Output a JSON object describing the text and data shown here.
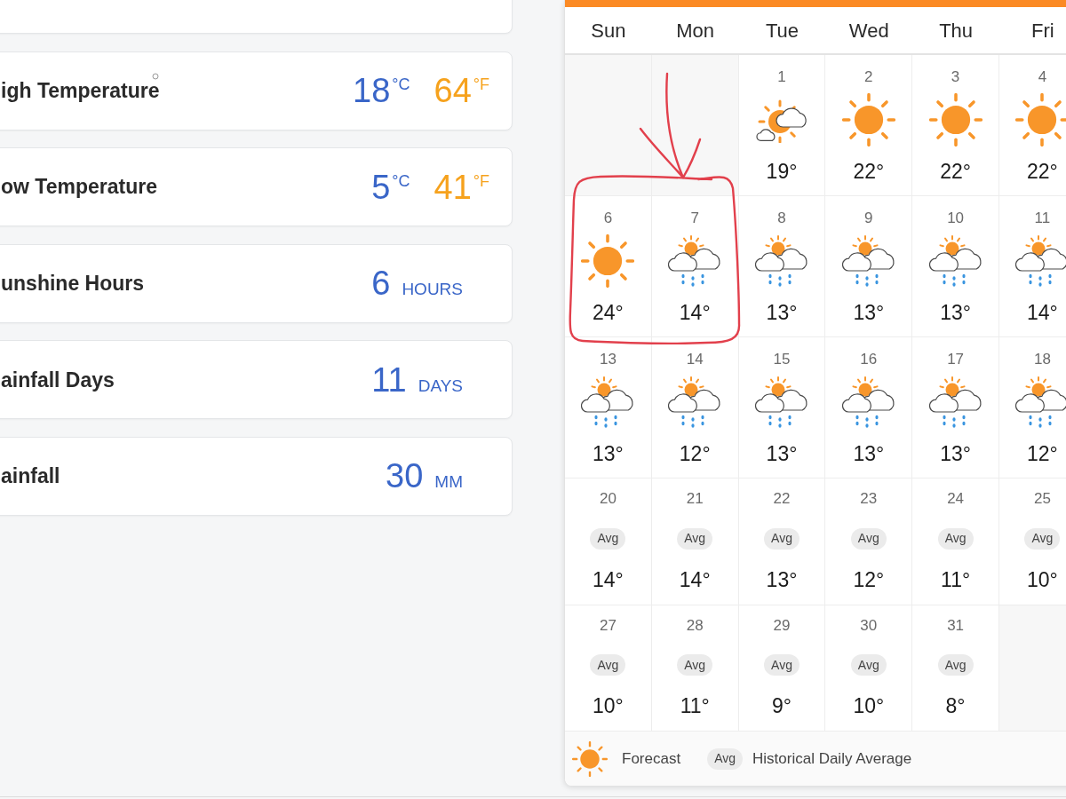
{
  "stats": [
    {
      "kind": "cut-off"
    },
    {
      "kind": "temperature",
      "label": "igh Temperature",
      "ring_mark": true,
      "readings": [
        {
          "value": "18",
          "unit": "°C",
          "color": "#3a66c8"
        },
        {
          "value": "64",
          "unit": "°F",
          "color": "#f6a21d"
        }
      ]
    },
    {
      "kind": "temperature",
      "label": "ow Temperature",
      "readings": [
        {
          "value": "5",
          "unit": "°C",
          "color": "#3a66c8"
        },
        {
          "value": "41",
          "unit": "°F",
          "color": "#f6a21d"
        }
      ]
    },
    {
      "kind": "amount",
      "label": "unshine Hours",
      "readings": [
        {
          "value": "6",
          "unit": "HOURS",
          "color": "#3a66c8"
        }
      ]
    },
    {
      "kind": "amount",
      "label": "ainfall Days",
      "readings": [
        {
          "value": "11",
          "unit": "DAYS",
          "color": "#3a66c8"
        }
      ]
    },
    {
      "kind": "amount",
      "label": "ainfall",
      "readings": [
        {
          "value": "30",
          "unit": "MM",
          "color": "#3a66c8"
        }
      ]
    }
  ],
  "calendar": {
    "weekdays": [
      "Sun",
      "Mon",
      "Tue",
      "Wed",
      "Thu",
      "Fri"
    ],
    "weeks": [
      [
        {
          "kind": "empty"
        },
        {
          "kind": "empty"
        },
        {
          "kind": "partly-cloudy",
          "date": "1",
          "temp": "19°"
        },
        {
          "kind": "sunny",
          "date": "2",
          "temp": "22°"
        },
        {
          "kind": "sunny",
          "date": "3",
          "temp": "22°"
        },
        {
          "kind": "sunny",
          "date": "4",
          "temp": "22°"
        }
      ],
      [
        {
          "kind": "sunny",
          "date": "6",
          "temp": "24°"
        },
        {
          "kind": "showers",
          "date": "7",
          "temp": "14°"
        },
        {
          "kind": "showers",
          "date": "8",
          "temp": "13°"
        },
        {
          "kind": "showers",
          "date": "9",
          "temp": "13°"
        },
        {
          "kind": "showers",
          "date": "10",
          "temp": "13°"
        },
        {
          "kind": "showers",
          "date": "11",
          "temp": "14°"
        }
      ],
      [
        {
          "kind": "showers",
          "date": "13",
          "temp": "13°"
        },
        {
          "kind": "showers",
          "date": "14",
          "temp": "12°"
        },
        {
          "kind": "showers",
          "date": "15",
          "temp": "13°"
        },
        {
          "kind": "showers",
          "date": "16",
          "temp": "13°"
        },
        {
          "kind": "showers",
          "date": "17",
          "temp": "13°"
        },
        {
          "kind": "showers",
          "date": "18",
          "temp": "12°"
        }
      ],
      [
        {
          "kind": "average",
          "date": "20",
          "badge": "Avg",
          "temp": "14°"
        },
        {
          "kind": "average",
          "date": "21",
          "badge": "Avg",
          "temp": "14°"
        },
        {
          "kind": "average",
          "date": "22",
          "badge": "Avg",
          "temp": "13°"
        },
        {
          "kind": "average",
          "date": "23",
          "badge": "Avg",
          "temp": "12°"
        },
        {
          "kind": "average",
          "date": "24",
          "badge": "Avg",
          "temp": "11°"
        },
        {
          "kind": "average",
          "date": "25",
          "badge": "Avg",
          "temp": "10°"
        }
      ],
      [
        {
          "kind": "average",
          "date": "27",
          "badge": "Avg",
          "temp": "10°"
        },
        {
          "kind": "average",
          "date": "28",
          "badge": "Avg",
          "temp": "11°"
        },
        {
          "kind": "average",
          "date": "29",
          "badge": "Avg",
          "temp": "9°"
        },
        {
          "kind": "average",
          "date": "30",
          "badge": "Avg",
          "temp": "10°"
        },
        {
          "kind": "average",
          "date": "31",
          "badge": "Avg",
          "temp": "8°"
        },
        {
          "kind": "empty"
        }
      ]
    ],
    "legend": [
      {
        "kind": "forecast",
        "label": "Forecast"
      },
      {
        "kind": "average",
        "badge": "Avg",
        "label": "Historical Daily Average"
      }
    ]
  },
  "hand_drawn_marks": {
    "arrow": true,
    "loop": true
  }
}
